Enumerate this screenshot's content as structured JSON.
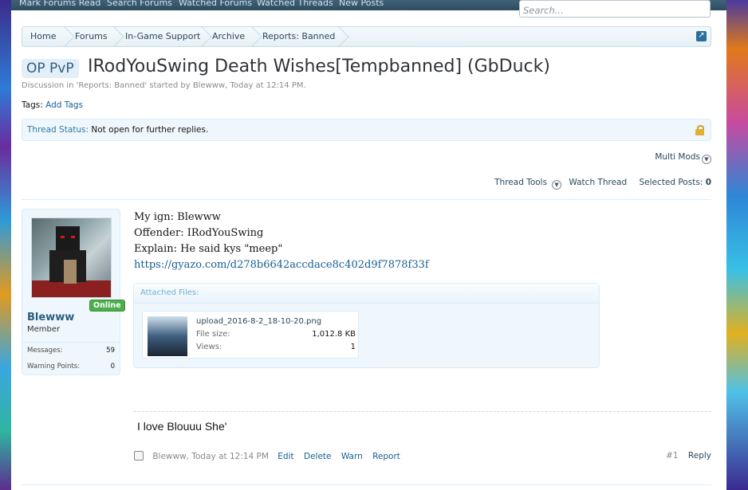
{
  "topnav": [
    "Mark Forums Read",
    "Search Forums",
    "Watched Forums",
    "Watched Threads",
    "New Posts"
  ],
  "search_placeholder": "Search...",
  "breadcrumbs": [
    "Home",
    "Forums",
    "In-Game Support",
    "Archive",
    "Reports: Banned"
  ],
  "thread": {
    "prefix": "OP PvP",
    "title": "IRodYouSwing Death Wishes[Tempbanned] (GbDuck)",
    "meta": "Discussion in 'Reports: Banned' started by Blewww, Today at 12:14 PM.",
    "tags_label": "Tags:",
    "tags_link": "Add Tags",
    "status_label": "Thread Status:",
    "status_value": "Not open for further replies."
  },
  "multimods": "Multi Mods",
  "tools": {
    "thread_tools": "Thread Tools",
    "watch": "Watch Thread",
    "selected_label": "Selected Posts:",
    "selected_count": "0"
  },
  "user": {
    "name": "Blewww",
    "title": "Member",
    "online": "Online",
    "stats": [
      {
        "label": "Messages:",
        "value": "59"
      },
      {
        "label": "Warning Points:",
        "value": "0"
      }
    ]
  },
  "post": {
    "lines": [
      "My ign: Blewww",
      "Offender: IRodYouSwing",
      "Explain: He said kys \"meep\""
    ],
    "link": "https://gyazo.com/d278b6642accdace8c402d9f7878f33f",
    "attach_head": "Attached Files:",
    "file": {
      "name": "upload_2016-8-2_18-10-20.png",
      "size_label": "File size:",
      "size": "1,012.8 KB",
      "views_label": "Views:",
      "views": "1"
    },
    "signature": "I love Blouuu She'",
    "author": "Blewww, Today at 12:14 PM",
    "actions": [
      "Edit",
      "Delete",
      "Warn",
      "Report"
    ],
    "number": "#1",
    "reply": "Reply"
  }
}
